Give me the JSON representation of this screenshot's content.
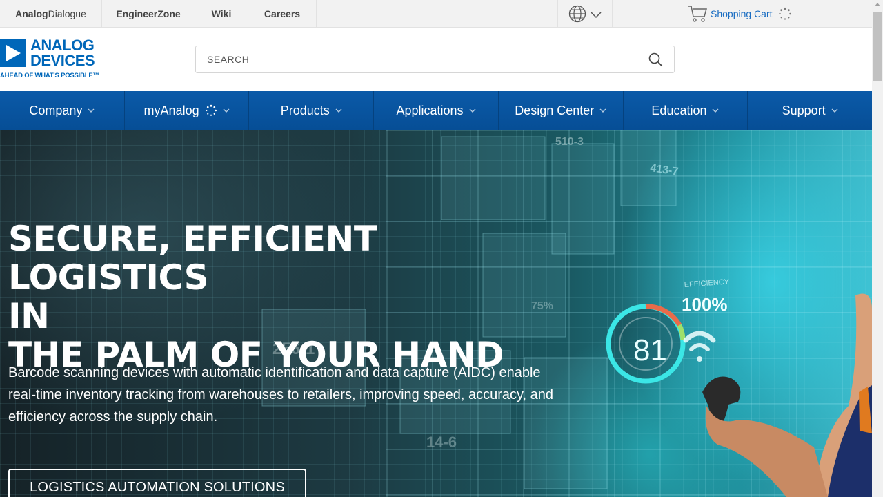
{
  "utility": {
    "links": [
      {
        "bold": "Analog",
        "light": "Dialogue"
      },
      {
        "bold": "EngineerZone",
        "light": ""
      },
      {
        "bold": "Wiki",
        "light": ""
      },
      {
        "bold": "Careers",
        "light": ""
      }
    ],
    "cart_label": "Shopping Cart"
  },
  "brand": {
    "line1": "ANALOG",
    "line2": "DEVICES",
    "tagline": "AHEAD OF WHAT'S POSSIBLE™",
    "color": "#0067b9"
  },
  "search": {
    "placeholder": "SEARCH"
  },
  "nav": {
    "items": [
      {
        "label": "Company"
      },
      {
        "label": "myAnalog"
      },
      {
        "label": "Products"
      },
      {
        "label": "Applications"
      },
      {
        "label": "Design Center"
      },
      {
        "label": "Education"
      },
      {
        "label": "Support"
      }
    ],
    "color": "#0b5aa8"
  },
  "hero": {
    "headline_line1": "SECURE, EFFICIENT LOGISTICS",
    "headline_line2": "IN",
    "headline_line3": "THE PALM OF YOUR HAND",
    "subtext": "Barcode scanning devices with automatic identification and data capture (AIDC) enable real-time inventory tracking from warehouses to retailers, improving speed, accuracy, and efficiency across the supply chain.",
    "cta_label": "LOGISTICS AUTOMATION SOLUTIONS",
    "image_text": {
      "gauge_value": "81",
      "efficiency_label": "EFFICIENCY",
      "efficiency_value": "100%",
      "tag1": "413-7",
      "tag2": "256-1",
      "tag3": "14-6",
      "tag4": "75%",
      "tag5": "510-3"
    }
  }
}
